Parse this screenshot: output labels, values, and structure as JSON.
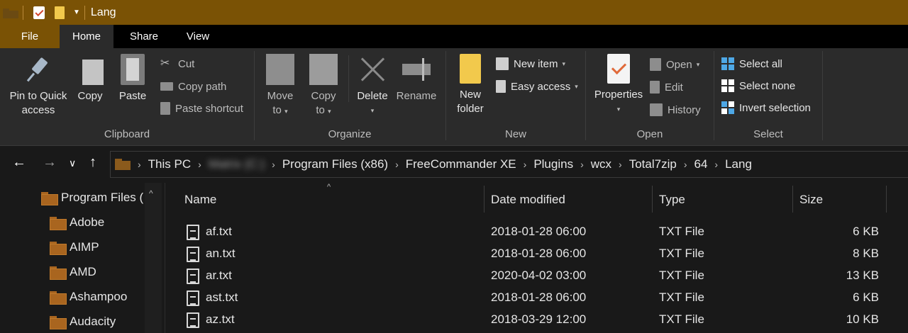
{
  "window": {
    "title": "Lang"
  },
  "tabs": [
    "File",
    "Home",
    "Share",
    "View"
  ],
  "ribbon": {
    "clipboard": {
      "label": "Clipboard",
      "pin_line1": "Pin to Quick",
      "pin_line2": "access",
      "copy": "Copy",
      "paste": "Paste",
      "cut": "Cut",
      "copy_path": "Copy path",
      "paste_shortcut": "Paste shortcut"
    },
    "organize": {
      "label": "Organize",
      "move_line1": "Move",
      "move_line2": "to",
      "copy_line1": "Copy",
      "copy_line2": "to",
      "delete": "Delete",
      "rename": "Rename"
    },
    "new": {
      "label": "New",
      "folder_line1": "New",
      "folder_line2": "folder",
      "new_item": "New item",
      "easy_access": "Easy access"
    },
    "open": {
      "label": "Open",
      "properties": "Properties",
      "open": "Open",
      "edit": "Edit",
      "history": "History"
    },
    "select": {
      "label": "Select",
      "select_all": "Select all",
      "select_none": "Select none",
      "invert_selection": "Invert selection"
    }
  },
  "address": {
    "crumbs": [
      "This PC",
      "Matrix (C:)",
      "Program Files (x86)",
      "FreeCommander XE",
      "Plugins",
      "wcx",
      "Total7zip",
      "64",
      "Lang"
    ]
  },
  "tree": {
    "items": [
      "Program Files (",
      "Adobe",
      "AIMP",
      "AMD",
      "Ashampoo",
      "Audacity"
    ]
  },
  "list": {
    "columns": {
      "name": "Name",
      "date": "Date modified",
      "type": "Type",
      "size": "Size"
    },
    "files": [
      {
        "name": "af.txt",
        "date": "2018-01-28 06:00",
        "type": "TXT File",
        "size": "6 KB"
      },
      {
        "name": "an.txt",
        "date": "2018-01-28 06:00",
        "type": "TXT File",
        "size": "8 KB"
      },
      {
        "name": "ar.txt",
        "date": "2020-04-02 03:00",
        "type": "TXT File",
        "size": "13 KB"
      },
      {
        "name": "ast.txt",
        "date": "2018-01-28 06:00",
        "type": "TXT File",
        "size": "6 KB"
      },
      {
        "name": "az.txt",
        "date": "2018-03-29 12:00",
        "type": "TXT File",
        "size": "10 KB"
      }
    ]
  }
}
